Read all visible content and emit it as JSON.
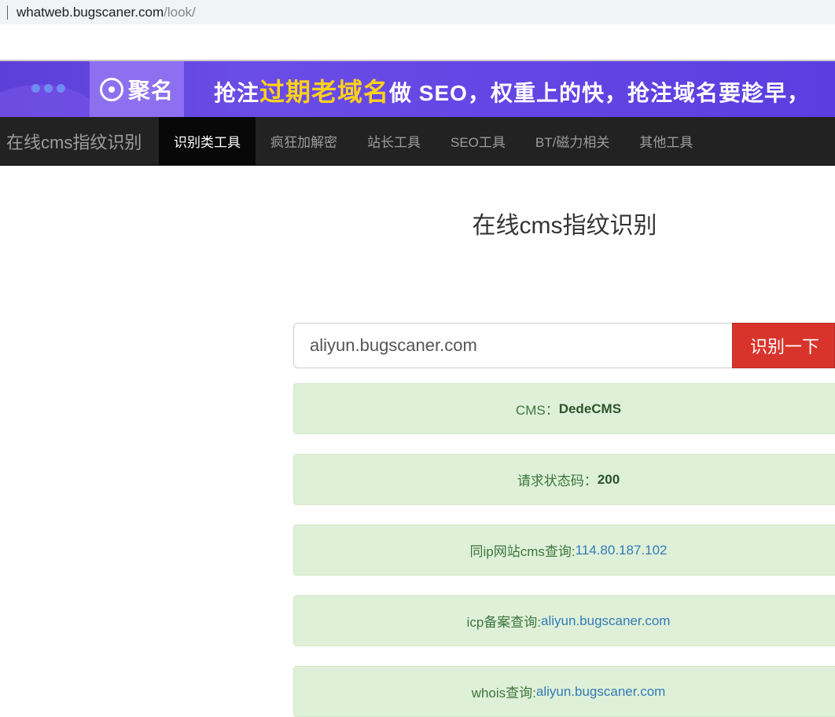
{
  "browser": {
    "url_host": "whatweb.bugscaner.com",
    "url_path": "/look/"
  },
  "ad": {
    "logo_text": "聚名",
    "slogan_prefix": "抢注",
    "slogan_highlight": "过期老域名",
    "slogan_suffix": "做 SEO，权重上的快，抢注域名要趁早，"
  },
  "nav": {
    "brand": "在线cms指纹识别",
    "items": [
      {
        "label": "识别类工具",
        "active": true
      },
      {
        "label": "疯狂加解密",
        "active": false
      },
      {
        "label": "站长工具",
        "active": false
      },
      {
        "label": "SEO工具",
        "active": false
      },
      {
        "label": "BT/磁力相关",
        "active": false
      },
      {
        "label": "其他工具",
        "active": false
      }
    ]
  },
  "main": {
    "title": "在线cms指纹识别",
    "search_value": "aliyun.bugscaner.com",
    "search_button": "识别一下"
  },
  "results": {
    "cms": {
      "label": "CMS：",
      "value": "DedeCMS"
    },
    "status": {
      "label": "请求状态码：",
      "value": "200"
    },
    "same_ip": {
      "label": "同ip网站cms查询:",
      "value": "114.80.187.102"
    },
    "icp": {
      "label": "icp备案查询:",
      "value": "aliyun.bugscaner.com"
    },
    "whois": {
      "label": "whois查询:",
      "value": "aliyun.bugscaner.com"
    }
  },
  "colors": {
    "nav_bg": "#222222",
    "button_red": "#d9342b",
    "result_bg": "#dff0d8",
    "result_text": "#3c763d",
    "link": "#337ab7",
    "ad_purple": "#5b3fd6",
    "ad_highlight": "#ffd11a"
  }
}
